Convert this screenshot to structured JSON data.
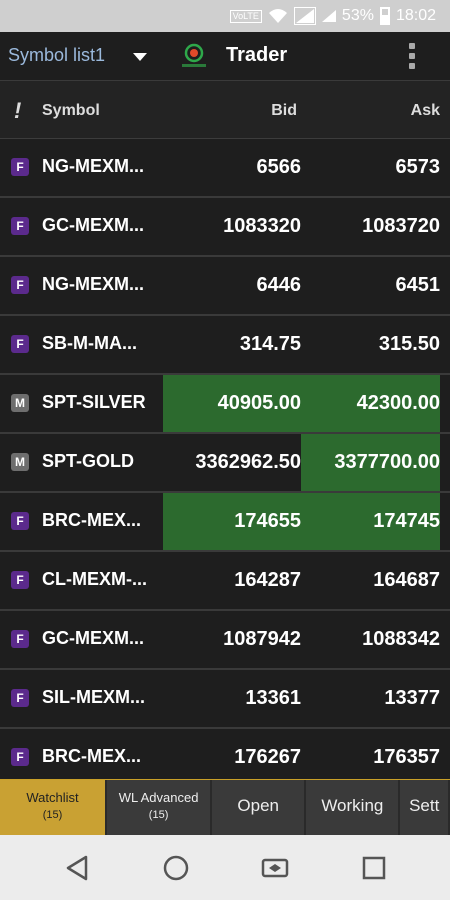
{
  "status_bar": {
    "battery": "53%",
    "time": "18:02",
    "network_label": "VoLTE"
  },
  "app_bar": {
    "symbol_list": "Symbol list1",
    "title": "Trader"
  },
  "table": {
    "headers": {
      "flag": "!",
      "symbol": "Symbol",
      "bid": "Bid",
      "ask": "Ask"
    },
    "rows": [
      {
        "type": "F",
        "symbol": "NG-MEXM...",
        "bid": "6566",
        "ask": "6573",
        "bid_hl": false,
        "ask_hl": false
      },
      {
        "type": "F",
        "symbol": "GC-MEXM...",
        "bid": "1083320",
        "ask": "1083720",
        "bid_hl": false,
        "ask_hl": false
      },
      {
        "type": "F",
        "symbol": "NG-MEXM...",
        "bid": "6446",
        "ask": "6451",
        "bid_hl": false,
        "ask_hl": false
      },
      {
        "type": "F",
        "symbol": "SB-M-MA...",
        "bid": "314.75",
        "ask": "315.50",
        "bid_hl": false,
        "ask_hl": false
      },
      {
        "type": "M",
        "symbol": "SPT-SILVER",
        "bid": "40905.00",
        "ask": "42300.00",
        "bid_hl": true,
        "ask_hl": true
      },
      {
        "type": "M",
        "symbol": "SPT-GOLD",
        "bid": "3362962.50",
        "ask": "3377700.00",
        "bid_hl": false,
        "ask_hl": true
      },
      {
        "type": "F",
        "symbol": "BRC-MEX...",
        "bid": "174655",
        "ask": "174745",
        "bid_hl": true,
        "ask_hl": true
      },
      {
        "type": "F",
        "symbol": "CL-MEXM-...",
        "bid": "164287",
        "ask": "164687",
        "bid_hl": false,
        "ask_hl": false
      },
      {
        "type": "F",
        "symbol": "GC-MEXM...",
        "bid": "1087942",
        "ask": "1088342",
        "bid_hl": false,
        "ask_hl": false
      },
      {
        "type": "F",
        "symbol": "SIL-MEXM...",
        "bid": "13361",
        "ask": "13377",
        "bid_hl": false,
        "ask_hl": false
      },
      {
        "type": "F",
        "symbol": "BRC-MEX...",
        "bid": "176267",
        "ask": "176357",
        "bid_hl": false,
        "ask_hl": false
      }
    ]
  },
  "tabs": [
    {
      "label": "Watchlist",
      "count": "(15)",
      "active": true
    },
    {
      "label": "WL Advanced",
      "count": "(15)",
      "active": false
    },
    {
      "label": "Open",
      "count": "",
      "active": false
    },
    {
      "label": "Working",
      "count": "",
      "active": false
    },
    {
      "label": "Sett",
      "count": "",
      "active": false
    }
  ],
  "colors": {
    "highlight": "#2c6a2e",
    "future_badge": "#5b2a8c",
    "market_badge": "#6e6e6e",
    "active_tab": "#c9a133",
    "accent_line": "#c9a028"
  }
}
